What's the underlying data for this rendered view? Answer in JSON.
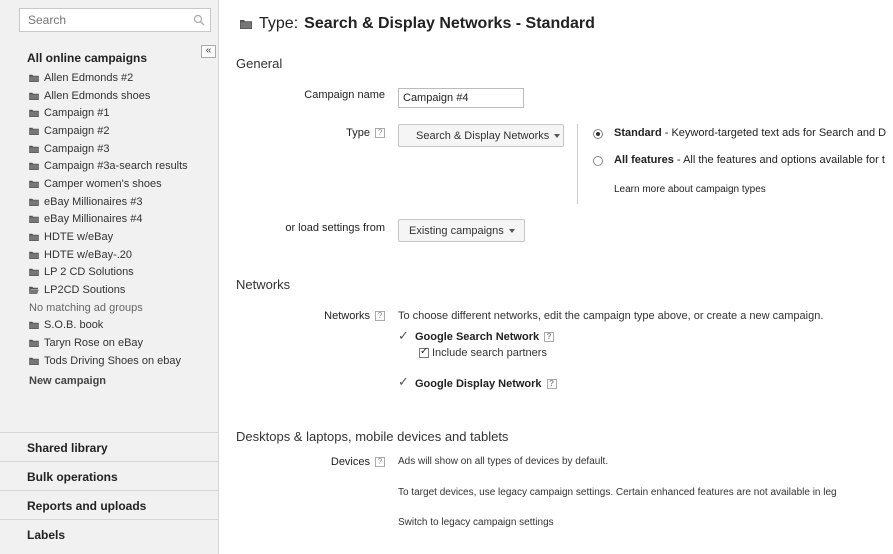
{
  "sidebar": {
    "search_placeholder": "Search",
    "panel_title": "All online campaigns",
    "collapse_label": "«",
    "campaigns": [
      "Allen Edmonds #2",
      "Allen Edmonds shoes",
      "Campaign #1",
      "Campaign #2",
      "Campaign #3",
      "Campaign #3a-search results",
      "Camper women's shoes",
      "eBay Millionaires #3",
      "eBay Millionaires #4",
      "HDTE w/eBay",
      "HDTE w/eBay-.20",
      "LP 2 CD Solutions",
      "LP2CD Soutions"
    ],
    "sub_note": "No matching ad groups",
    "campaigns_after": [
      "S.O.B. book",
      "Taryn Rose on eBay",
      "Tods Driving Shoes on ebay"
    ],
    "new_campaign": "New campaign",
    "sections": [
      "Shared library",
      "Bulk operations",
      "Reports and uploads",
      "Labels"
    ]
  },
  "header": {
    "type_prefix": "Type:",
    "type_name": "Search & Display Networks - Standard"
  },
  "general": {
    "heading": "General",
    "campaign_name_label": "Campaign name",
    "campaign_name_value": "Campaign #4",
    "type_label": "Type",
    "type_button": "Search & Display Networks",
    "standard_bold": "Standard",
    "standard_desc": " - Keyword-targeted text ads for Search and D",
    "all_features_bold": "All features",
    "all_features_desc": " - All the features and options available for t",
    "learn_more": "Learn more about campaign types",
    "load_label": "or load settings from",
    "load_button": "Existing campaigns"
  },
  "networks": {
    "heading": "Networks",
    "label": "Networks",
    "note": "To choose different networks, edit the campaign type above, or create a new campaign.",
    "search_network": "Google Search Network",
    "include_partners": "Include search partners",
    "display_network": "Google Display Network"
  },
  "devices": {
    "heading": "Desktops & laptops, mobile devices and tablets",
    "label": "Devices",
    "note": "Ads will show on all types of devices by default.",
    "legacy_note": "To target devices, use legacy campaign settings. Certain enhanced features are not available in leg",
    "switch_link": "Switch to legacy campaign settings"
  },
  "help_glyph": "?",
  "check_glyph": "✓",
  "colors": {
    "sidebar_bg": "#f1f1f1",
    "folder": "#555555",
    "border": "#d6d6d6"
  }
}
